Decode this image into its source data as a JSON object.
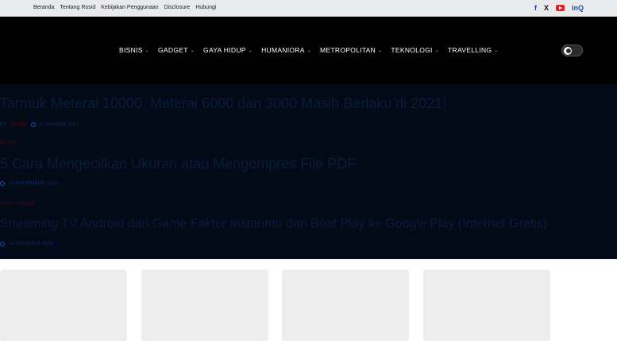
{
  "topbar": {
    "links": [
      "Beranda",
      "Tentang Rosid",
      "Kebijakan Penggunaan",
      "Disclosure",
      "Hubungi"
    ],
    "social": {
      "facebook": "f",
      "x": "X",
      "inq": "inQ"
    }
  },
  "nav": {
    "items": [
      "BISNIS",
      "GADGET",
      "GAYA HIDUP",
      "HUMANIORA",
      "METROPOLITAN",
      "TEKNOLOGI",
      "TRAVELLING"
    ],
    "chevron": "⌄"
  },
  "posts": [
    {
      "title": "Tarmuk Meterai 10000, Meterai 6000 dan 3000 Masih Berlaku di 2021!",
      "by_label": "BY",
      "author": "ROSID",
      "date": "5 JANUARI 2021",
      "category": ""
    },
    {
      "title": "5 Cara Mengecilkan Ukuran atau Mengompres File PDF",
      "by_label": "",
      "author": "",
      "date": "11 NOVEMBER 2020",
      "category": "BLOG"
    },
    {
      "title": "Streaming TV Android dari Game Faktor Instanmu dan Boat Play ke Google Play (Internet Gratis)",
      "by_label": "",
      "author": "",
      "date": "20 AGUSTUS 2020",
      "category": "GAYA HIDUP"
    }
  ],
  "colors": {
    "topbar_bg": "#e9eaec",
    "header_bg": "#000000",
    "overlay_bg": "#020a18",
    "accent": "#d8262b"
  }
}
